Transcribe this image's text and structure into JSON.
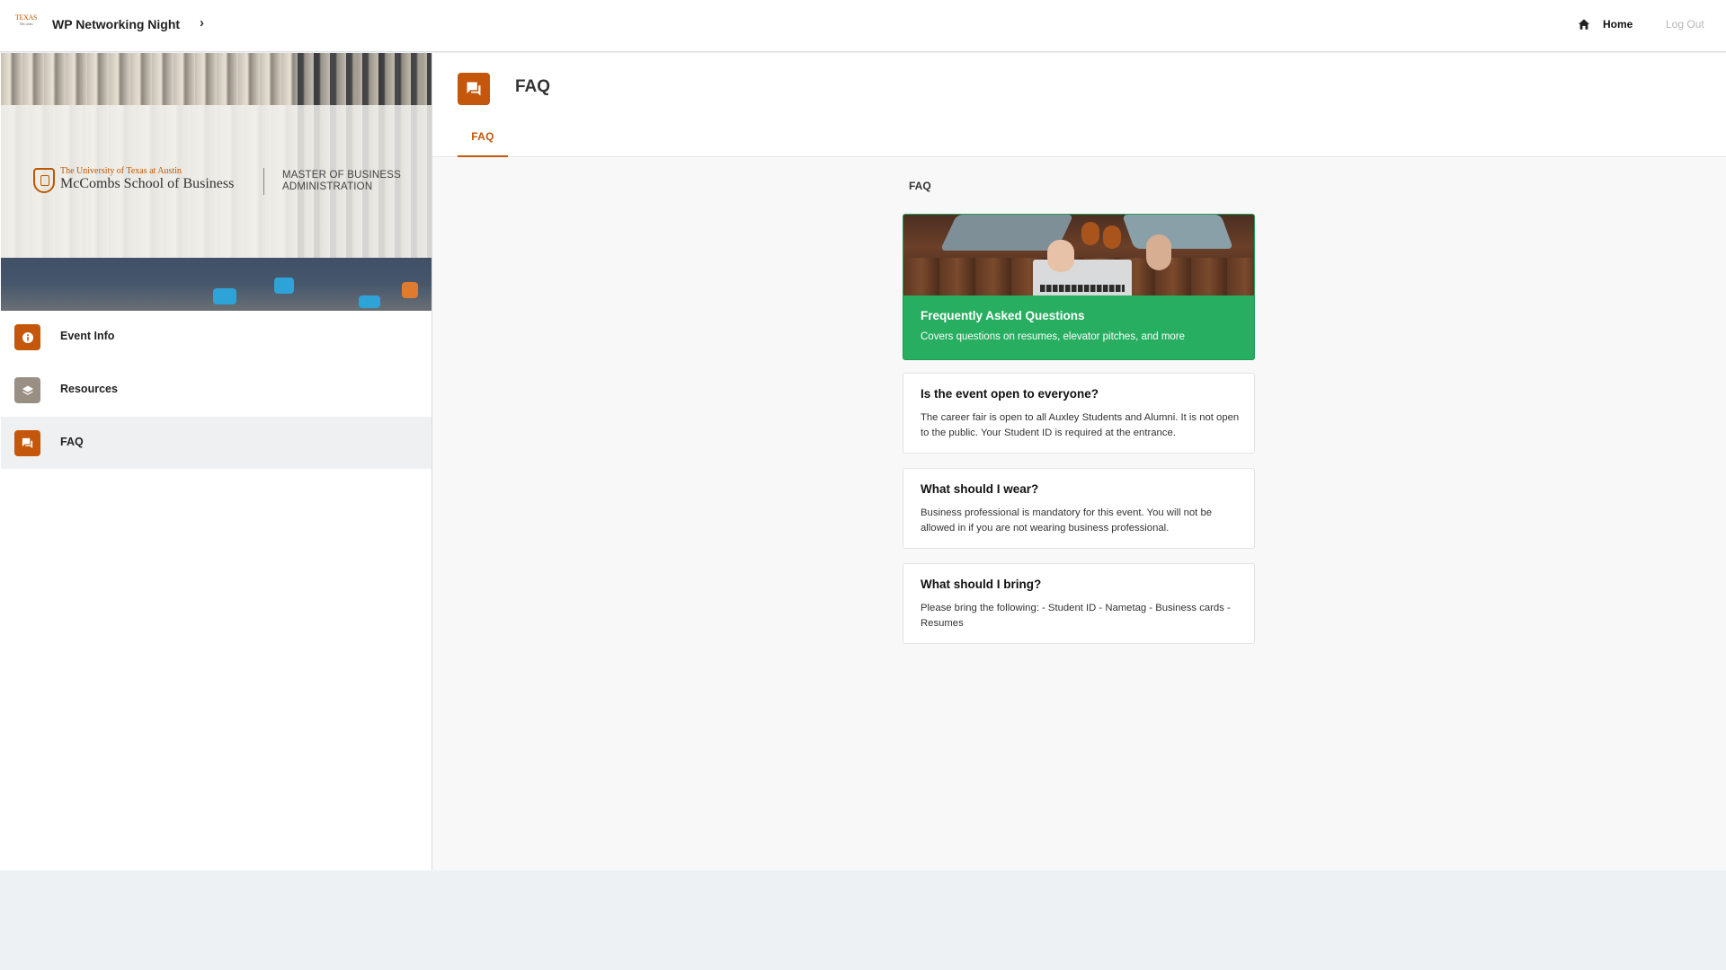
{
  "topbar": {
    "logo_text": "TEXAS",
    "logo_sub": "McCombs",
    "event_title": "WP Networking Night",
    "chevron": "›",
    "home_label": "Home",
    "logout_label": "Log Out",
    "home_icon": "home-icon"
  },
  "sidebar": {
    "banner": {
      "university": "The University of Texas at Austin",
      "school": "McCombs School of Business",
      "program": "MASTER OF BUSINESS ADMINISTRATION"
    },
    "items": [
      {
        "label": "Event Info",
        "icon": "info-icon",
        "icon_color": "#c4570b",
        "active": false
      },
      {
        "label": "Resources",
        "icon": "layers-icon",
        "icon_color": "#9a8f85",
        "active": false
      },
      {
        "label": "FAQ",
        "icon": "chat-icon",
        "icon_color": "#c4570b",
        "active": true
      }
    ]
  },
  "main": {
    "page_title": "FAQ",
    "tab_label": "FAQ",
    "section_label": "FAQ",
    "featured": {
      "title": "Frequently Asked Questions",
      "subtitle": "Covers questions on resumes, elevator pitches, and more",
      "color": "#27ae60"
    },
    "faqs": [
      {
        "question": "Is the event open to everyone?",
        "answer": "The career fair is open to all Auxley Students and Alumni. It is not open to the public. Your Student ID is required at the entrance."
      },
      {
        "question": "What should I wear?",
        "answer": "Business professional is mandatory for this event. You will not be allowed in if you are not wearing business professional."
      },
      {
        "question": "What should I bring?",
        "answer": "Please bring the following: - Student ID - Nametag - Business cards - Resumes"
      }
    ]
  },
  "colors": {
    "accent": "#c4570b",
    "success": "#27ae60"
  }
}
